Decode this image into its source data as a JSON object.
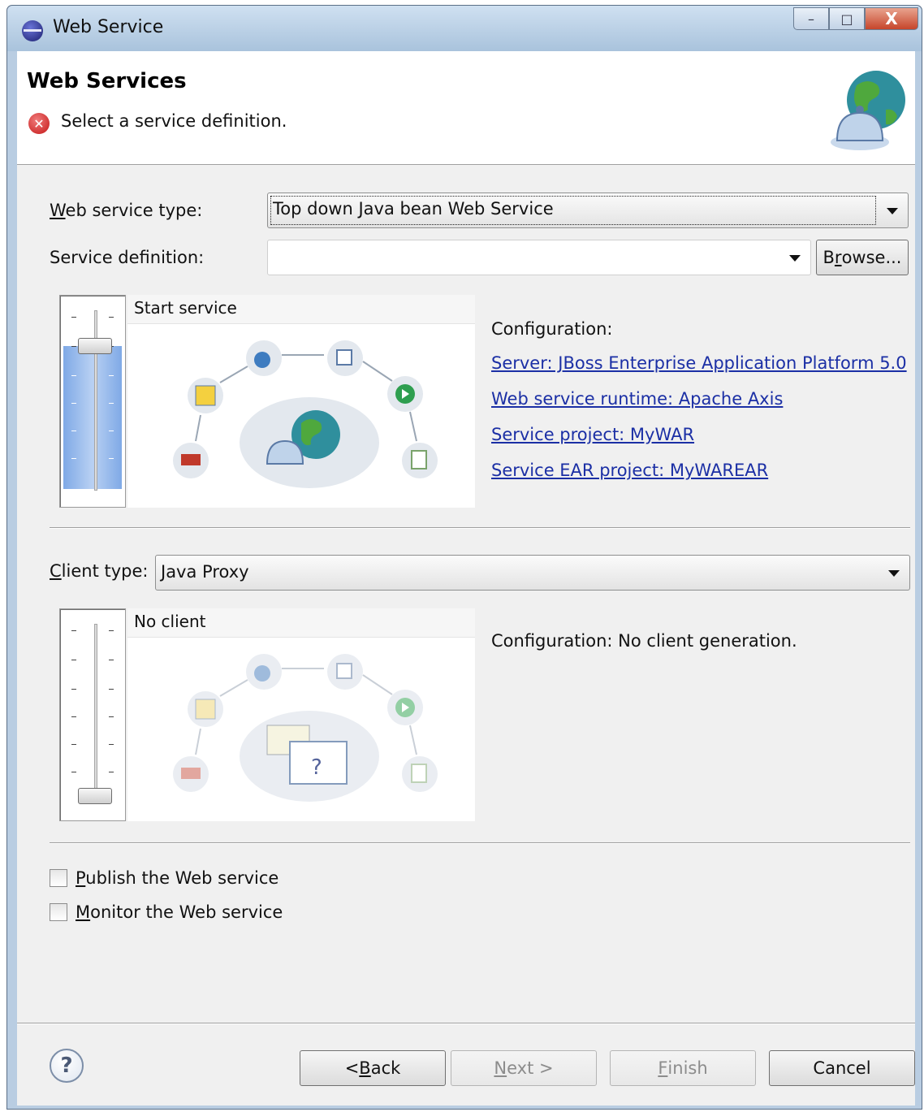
{
  "window": {
    "title": "Web Service",
    "controls": {
      "minimize": "–",
      "maximize": "□",
      "close": "X"
    }
  },
  "banner": {
    "heading": "Web Services",
    "message": "Select a service definition.",
    "error_icon": "error-icon",
    "image": "globe-bell-icon"
  },
  "service": {
    "type_label_u": "W",
    "type_label_rest": "eb service type:",
    "type_value": "Top down Java bean Web Service",
    "definition_label": "Service definition:",
    "definition_value": "",
    "browse_u": "r",
    "browse_pre": "B",
    "browse_post": "owse...",
    "preview_title": "Start service",
    "slider_level": "Start service",
    "config_title": "Configuration:",
    "links": [
      "Server: JBoss Enterprise Application Platform 5.0",
      "Web service runtime: Apache Axis",
      "Service project: MyWAR",
      "Service EAR project: MyWAREAR"
    ]
  },
  "client": {
    "type_label_u": "C",
    "type_label_rest": "lient type:",
    "type_value": "Java Proxy",
    "preview_title": "No client",
    "slider_level": "No client",
    "config_text": "Configuration: No client generation."
  },
  "options": [
    {
      "u": "P",
      "rest": "ublish the Web service",
      "checked": false
    },
    {
      "u": "M",
      "rest": "onitor the Web service",
      "checked": false
    }
  ],
  "footer": {
    "help": "?",
    "back_pre": "< ",
    "back_u": "B",
    "back_post": "ack",
    "next_u": "N",
    "next_post": "ext >",
    "finish_u": "F",
    "finish_post": "inish",
    "cancel": "Cancel"
  },
  "colors": {
    "link": "#1b2fa5",
    "slider_fill": "#9dbdef",
    "error": "#c41616"
  }
}
